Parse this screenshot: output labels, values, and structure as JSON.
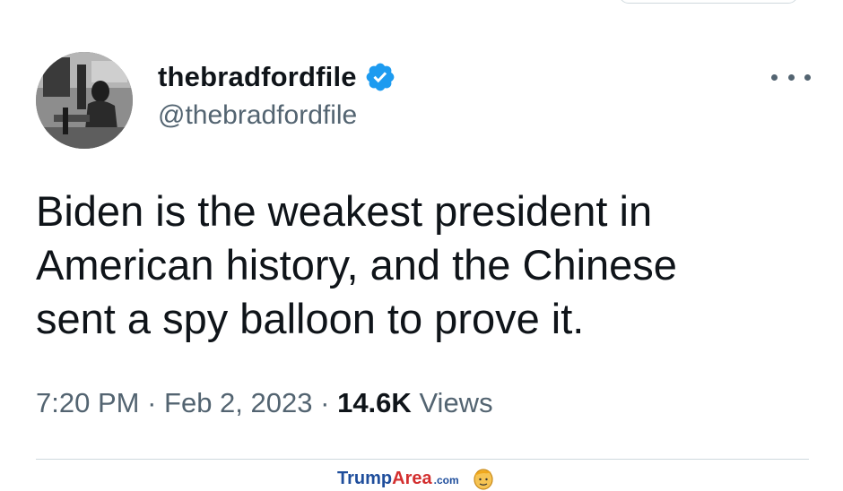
{
  "tweet": {
    "display_name": "thebradfordfile",
    "handle": "@thebradfordfile",
    "verified": true,
    "text_lines": [
      "Biden is the weakest president in",
      "American history, and the Chinese",
      "sent a spy balloon to prove it."
    ],
    "time": "7:20 PM",
    "separator": "·",
    "date": "Feb 2, 2023",
    "views_count": "14.6K",
    "views_label": "Views"
  },
  "watermark": {
    "brand_part1": "Trump",
    "brand_part2": "Area",
    "brand_suffix": ".com",
    "logo_icon": "trump-face-icon"
  },
  "colors": {
    "text_primary": "#0f1419",
    "text_secondary": "#536471",
    "verified_blue": "#1d9bf0",
    "divider": "#cfd9de"
  }
}
